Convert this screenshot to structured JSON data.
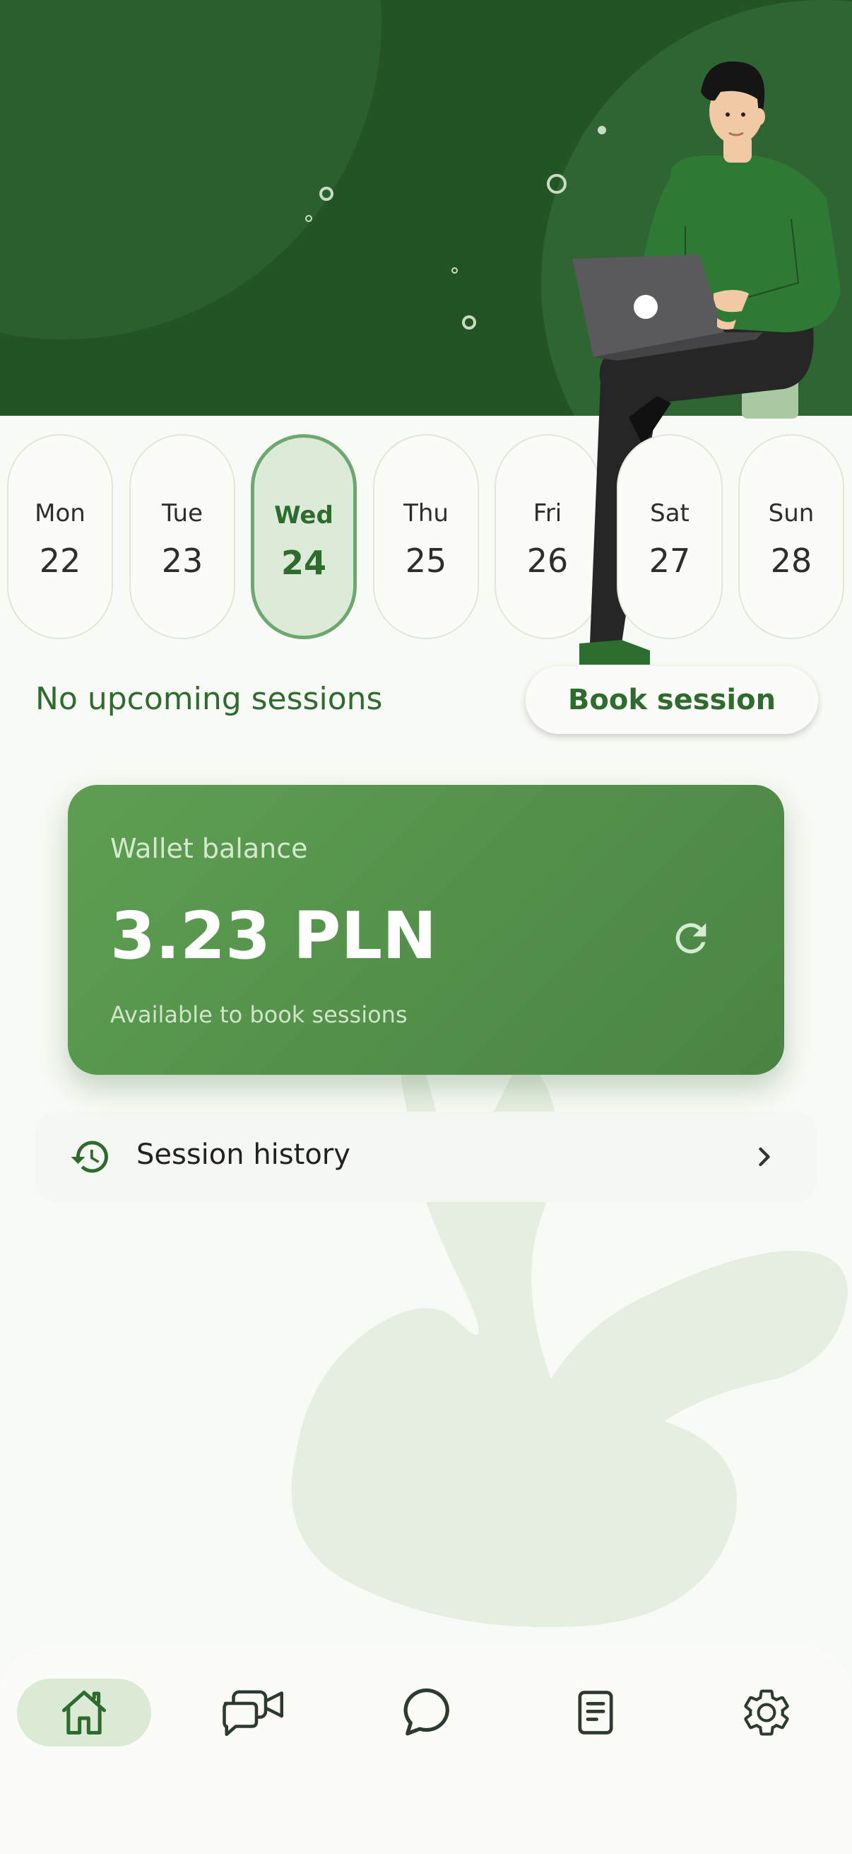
{
  "calendar": {
    "days": [
      {
        "name": "Mon",
        "num": "22"
      },
      {
        "name": "Tue",
        "num": "23"
      },
      {
        "name": "Wed",
        "num": "24"
      },
      {
        "name": "Thu",
        "num": "25"
      },
      {
        "name": "Fri",
        "num": "26"
      },
      {
        "name": "Sat",
        "num": "27"
      },
      {
        "name": "Sun",
        "num": "28"
      }
    ],
    "selected_index": 2
  },
  "sessions": {
    "status_text": "No upcoming sessions",
    "book_label": "Book session"
  },
  "wallet": {
    "label": "Wallet balance",
    "amount": "3.23 PLN",
    "subtitle": "Available to book sessions"
  },
  "history": {
    "label": "Session history"
  },
  "nav": {
    "items": [
      {
        "icon": "home-icon",
        "active": true
      },
      {
        "icon": "video-sessions-icon",
        "active": false
      },
      {
        "icon": "chat-icon",
        "active": false
      },
      {
        "icon": "notes-icon",
        "active": false
      },
      {
        "icon": "settings-icon",
        "active": false
      }
    ]
  },
  "colors": {
    "hero_green": "#245426",
    "accent_green": "#2f6b2f",
    "card_green": "#5e9f52",
    "background": "#f8faf5"
  }
}
